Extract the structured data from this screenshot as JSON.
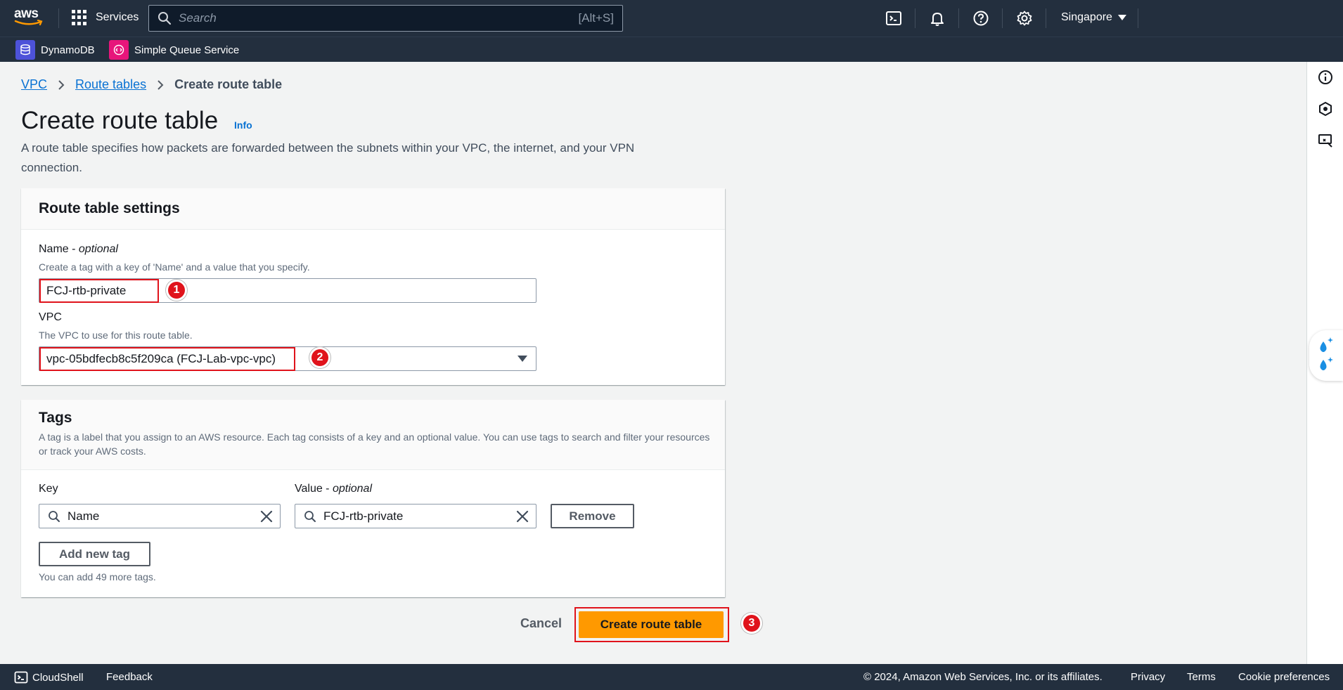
{
  "topnav": {
    "logo_text": "aws",
    "services_label": "Services",
    "search_placeholder": "Search",
    "search_shortcut": "[Alt+S]",
    "region": "Singapore",
    "icons": [
      "cloudshell-icon",
      "bell-icon",
      "help-icon",
      "settings-icon"
    ]
  },
  "favorites": [
    {
      "label": "DynamoDB",
      "icon": "dynamodb-icon",
      "color": "#4d52d9"
    },
    {
      "label": "Simple Queue Service",
      "icon": "sqs-icon",
      "color": "#e7157b"
    }
  ],
  "breadcrumb": {
    "items": [
      "VPC",
      "Route tables"
    ],
    "current": "Create route table"
  },
  "header": {
    "title": "Create route table",
    "info": "Info",
    "description": "A route table specifies how packets are forwarded between the subnets within your VPC, the internet, and your VPN connection."
  },
  "settings": {
    "title": "Route table settings",
    "name_label": "Name",
    "name_optional": "optional",
    "name_desc": "Create a tag with a key of 'Name' and a value that you specify.",
    "name_value": "FCJ-rtb-private",
    "vpc_label": "VPC",
    "vpc_desc": "The VPC to use for this route table.",
    "vpc_value": "vpc-05bdfecb8c5f209ca (FCJ-Lab-vpc-vpc)"
  },
  "tags": {
    "title": "Tags",
    "description": "A tag is a label that you assign to an AWS resource. Each tag consists of a key and an optional value. You can use tags to search and filter your resources or track your AWS costs.",
    "key_label": "Key",
    "value_label": "Value",
    "value_optional": "optional",
    "key_value": "Name",
    "value_value": "FCJ-rtb-private",
    "remove_label": "Remove",
    "add_label": "Add new tag",
    "limit_text": "You can add 49 more tags."
  },
  "actions": {
    "cancel": "Cancel",
    "create": "Create route table"
  },
  "steps": [
    "1",
    "2",
    "3"
  ],
  "footer": {
    "cloudshell": "CloudShell",
    "feedback": "Feedback",
    "copyright": "© 2024, Amazon Web Services, Inc. or its affiliates.",
    "privacy": "Privacy",
    "terms": "Terms",
    "cookies": "Cookie preferences"
  },
  "colors": {
    "nav_bg": "#232f3e",
    "primary": "#ff9900",
    "link": "#0972d3",
    "highlight": "#e0131b"
  }
}
